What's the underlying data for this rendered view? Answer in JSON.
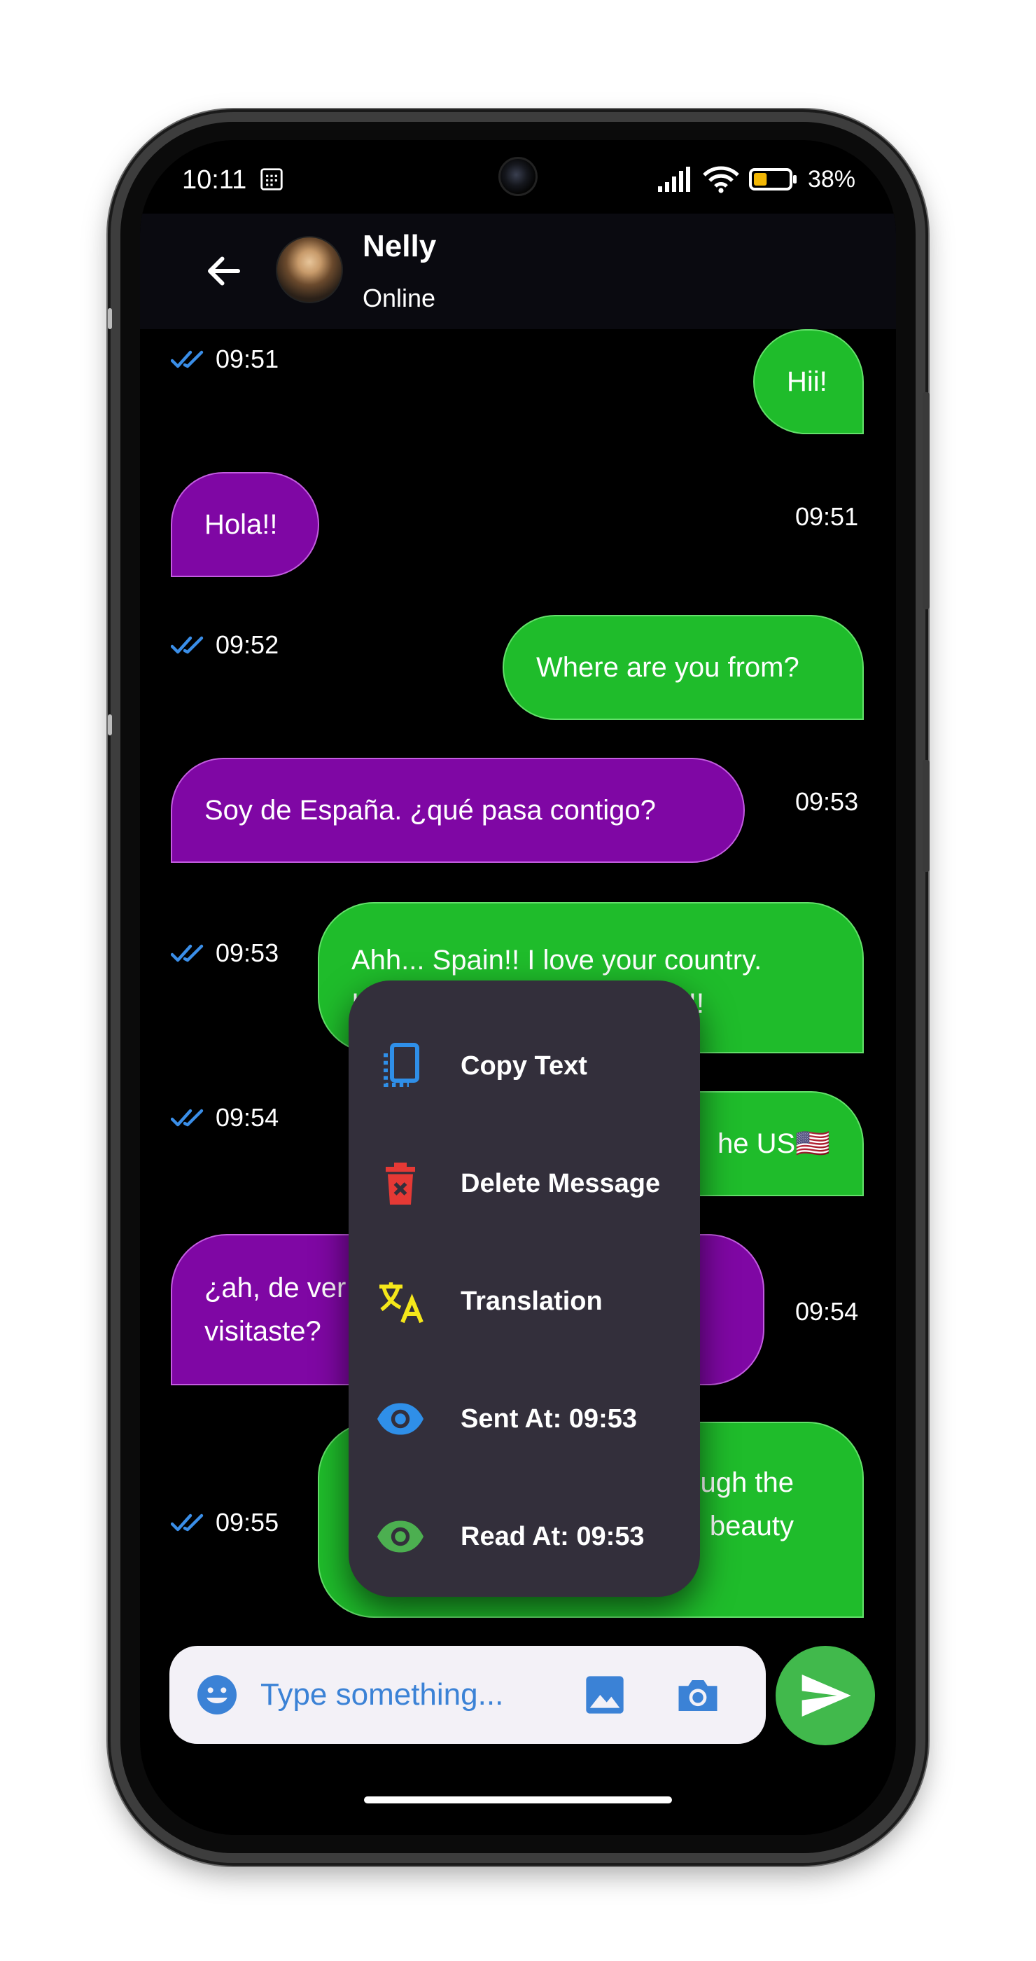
{
  "status_bar": {
    "time": "10:11",
    "battery_level": "38%",
    "battery_fraction": 0.38
  },
  "header": {
    "contact_name": "Nelly",
    "contact_status": "Online"
  },
  "messages": [
    {
      "direction": "out",
      "text": "Hii!",
      "time": "09:51"
    },
    {
      "direction": "in",
      "text": "Hola!!",
      "time": "09:51"
    },
    {
      "direction": "out",
      "text": "Where are you from?",
      "time": "09:52"
    },
    {
      "direction": "in",
      "text": "Soy de España. ¿qué pasa contigo?",
      "time": "09:53"
    },
    {
      "direction": "out",
      "text_line1": "Ahh... Spain!! I love your country.",
      "text_line2_start": "I",
      "text_line2_end": "r!!",
      "time": "09:53"
    },
    {
      "direction": "out",
      "text_visible": "he US🇺🇸",
      "time": "09:54"
    },
    {
      "direction": "in",
      "text_line1": "¿ah, de ver",
      "text_line2": "visitaste?",
      "time": "09:54"
    },
    {
      "direction": "out",
      "text_line1": "ugh the",
      "text_line2": "beauty",
      "time": "09:55"
    }
  ],
  "context_menu": {
    "items": [
      {
        "label": "Copy Text",
        "icon": "copy-icon",
        "color": "#2f8fe8"
      },
      {
        "label": "Delete Message",
        "icon": "trash-icon",
        "color": "#e53935"
      },
      {
        "label": "Translation",
        "icon": "translate-icon",
        "color": "#f5e71a"
      },
      {
        "label": "Sent At: 09:53",
        "icon": "eye-icon",
        "color": "#2f8fe8"
      },
      {
        "label": "Read At: 09:53",
        "icon": "eye-icon",
        "color": "#4caf50"
      }
    ]
  },
  "composer": {
    "placeholder": "Type something..."
  },
  "colors": {
    "outgoing_bubble": "#1fbc2b",
    "incoming_bubble": "#7f07a4",
    "menu_background": "#332f3b",
    "send_button": "#41b94c",
    "read_ticks": "#3a8ee8"
  }
}
